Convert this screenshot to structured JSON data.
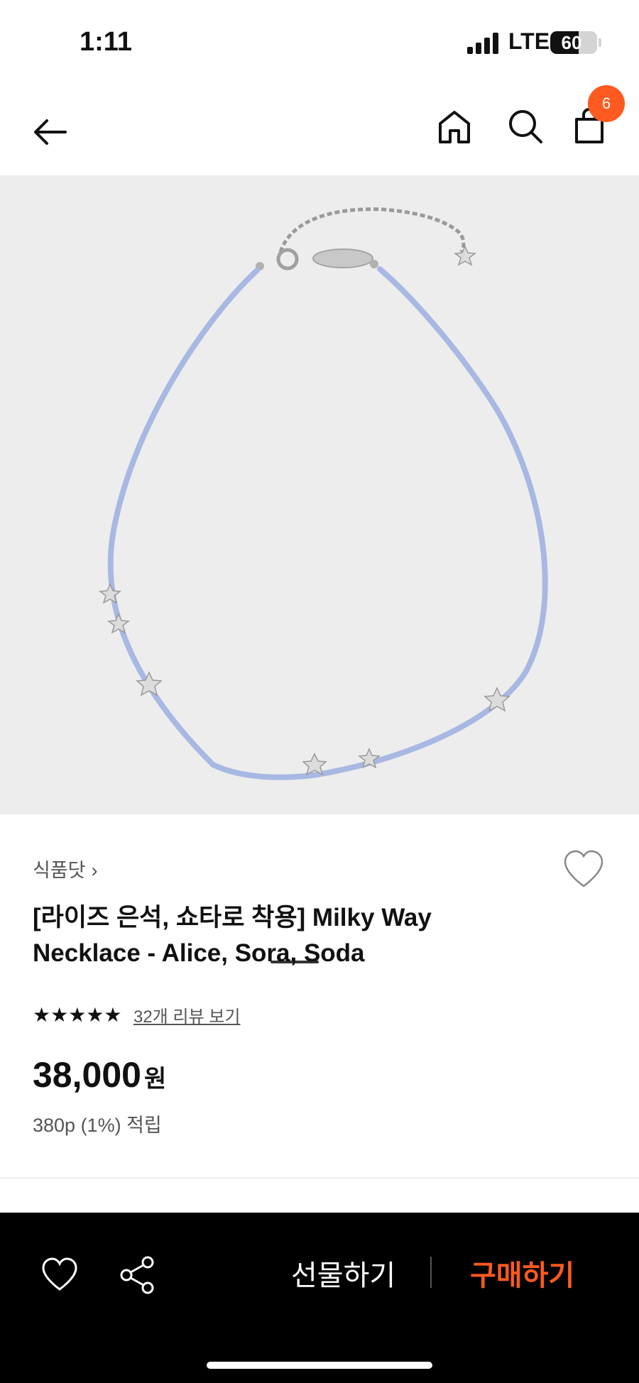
{
  "status_bar": {
    "time": "1:11",
    "network": "LTE",
    "battery": "60",
    "battery_level": 0.6
  },
  "nav": {
    "cart_badge": "6",
    "back_icon": "arrow-left-icon",
    "home_icon": "home-icon",
    "search_icon": "search-icon",
    "cart_icon": "shopping-bag-icon"
  },
  "product": {
    "brand": "식품닷",
    "brand_chevron": "›",
    "title": "[라이즈 은석, 쇼타로 착용] Milky Way Necklace - Alice, Sora, Soda",
    "stars": "★★★★★",
    "rating": 5,
    "review_link": "32개 리뷰 보기",
    "price": "38,000",
    "currency": "원",
    "points": "380p (1%) 적립",
    "image_background": "#ededed",
    "bead_color": "#a7b8e3"
  },
  "bottom_bar": {
    "gift_label": "선물하기",
    "buy_label": "구매하기",
    "accent": "#ff5a1f"
  }
}
